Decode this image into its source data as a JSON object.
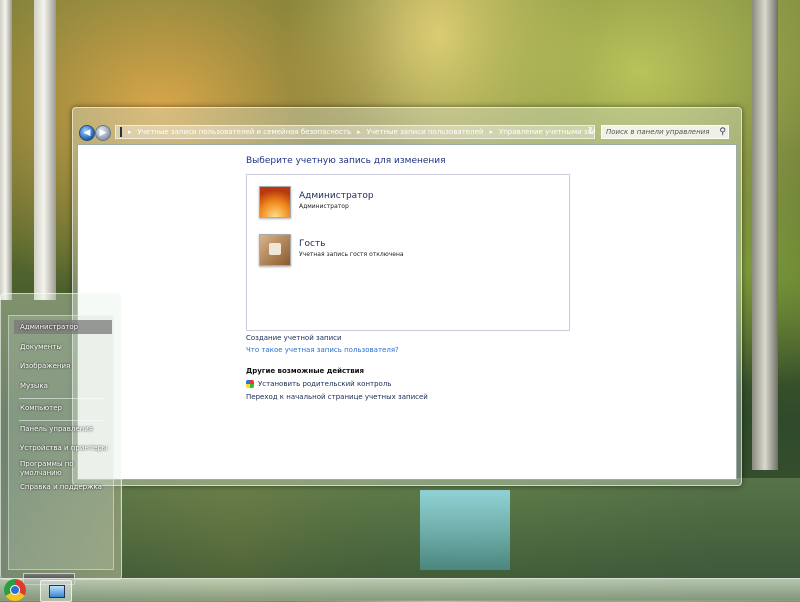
{
  "breadcrumb": [
    "Учетные записи пользователей и семейная безопасность",
    "Учетные записи пользователей",
    "Управление учетными записями"
  ],
  "search": {
    "placeholder": "Поиск в панели управления"
  },
  "content": {
    "heading": "Выберите учетную запись для изменения",
    "accounts": [
      {
        "name": "Администратор",
        "sub": "Администратор"
      },
      {
        "name": "Гость",
        "sub": "Учетная запись гостя отключена"
      }
    ],
    "create_link": "Создание учетной записи",
    "what_link": "Что такое учетная запись пользователя?",
    "other_title": "Другие возможные действия",
    "parental": "Установить родительский контроль",
    "home_link": "Переход к начальной странице учетных записей"
  },
  "start_menu": {
    "items": [
      "Администратор",
      "Документы",
      "Изображения",
      "Музыка",
      "Компьютер",
      "Панель управления",
      "Устройства и принтеры",
      "Программы по умолчанию",
      "Справка и поддержка"
    ]
  },
  "icons": {
    "back": "back-arrow-icon",
    "forward": "forward-arrow-icon",
    "search": "search-icon",
    "start": "start-orb-icon"
  }
}
